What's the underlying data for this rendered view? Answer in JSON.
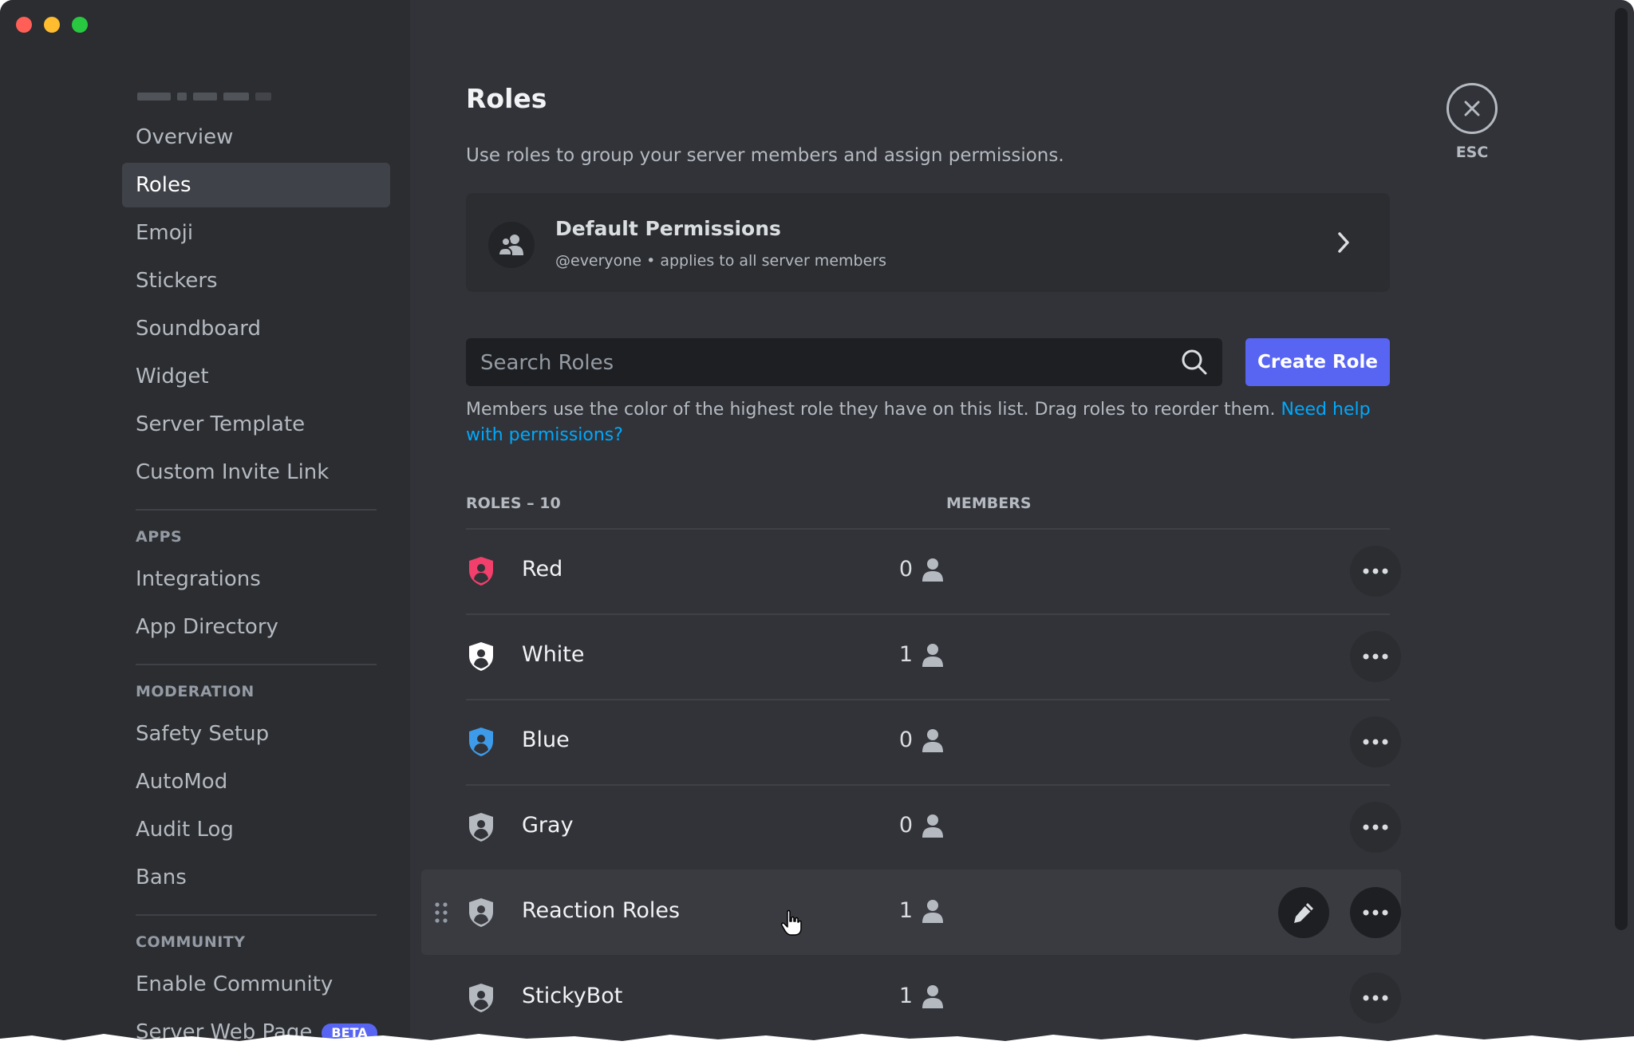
{
  "window": {
    "controls": [
      "close",
      "minimize",
      "maximize"
    ]
  },
  "sidebar": {
    "sections": [
      {
        "header": "",
        "items": [
          {
            "label": "Overview",
            "active": false
          },
          {
            "label": "Roles",
            "active": true
          },
          {
            "label": "Emoji",
            "active": false
          },
          {
            "label": "Stickers",
            "active": false
          },
          {
            "label": "Soundboard",
            "active": false
          },
          {
            "label": "Widget",
            "active": false
          },
          {
            "label": "Server Template",
            "active": false
          },
          {
            "label": "Custom Invite Link",
            "active": false
          }
        ]
      },
      {
        "header": "APPS",
        "items": [
          {
            "label": "Integrations",
            "active": false
          },
          {
            "label": "App Directory",
            "active": false
          }
        ]
      },
      {
        "header": "MODERATION",
        "items": [
          {
            "label": "Safety Setup",
            "active": false
          },
          {
            "label": "AutoMod",
            "active": false
          },
          {
            "label": "Audit Log",
            "active": false
          },
          {
            "label": "Bans",
            "active": false
          }
        ]
      },
      {
        "header": "COMMUNITY",
        "items": [
          {
            "label": "Enable Community",
            "active": false
          },
          {
            "label": "Server Web Page",
            "active": false,
            "badge": "BETA"
          }
        ]
      }
    ]
  },
  "page": {
    "title": "Roles",
    "description": "Use roles to group your server members and assign permissions.",
    "default_permissions": {
      "title": "Default Permissions",
      "subtitle": "@everyone • applies to all server members",
      "icon": "users-icon"
    },
    "search": {
      "placeholder": "Search Roles",
      "value": ""
    },
    "create_button": "Create Role",
    "help_text": "Members use the color of the highest role they have on this list. Drag roles to reorder them. ",
    "help_link": "Need help with permissions?",
    "columns": {
      "roles": "ROLES – 10",
      "members": "MEMBERS"
    },
    "roles": [
      {
        "name": "Red",
        "members": "0",
        "color": "#f23f6b",
        "hovered": false
      },
      {
        "name": "White",
        "members": "1",
        "color": "#ffffff",
        "hovered": false
      },
      {
        "name": "Blue",
        "members": "0",
        "color": "#3d9be9",
        "hovered": false
      },
      {
        "name": "Gray",
        "members": "0",
        "color": "#b5bac1",
        "hovered": false
      },
      {
        "name": "Reaction Roles",
        "members": "1",
        "color": "#b5bac1",
        "hovered": true
      },
      {
        "name": "StickyBot",
        "members": "1",
        "color": "#b5bac1",
        "hovered": false
      }
    ]
  },
  "close": {
    "label": "ESC",
    "icon": "close-icon"
  },
  "colors": {
    "accent": "#5865f2",
    "link": "#00a8fc",
    "background": "#313338",
    "sidebar": "#2b2d31"
  }
}
